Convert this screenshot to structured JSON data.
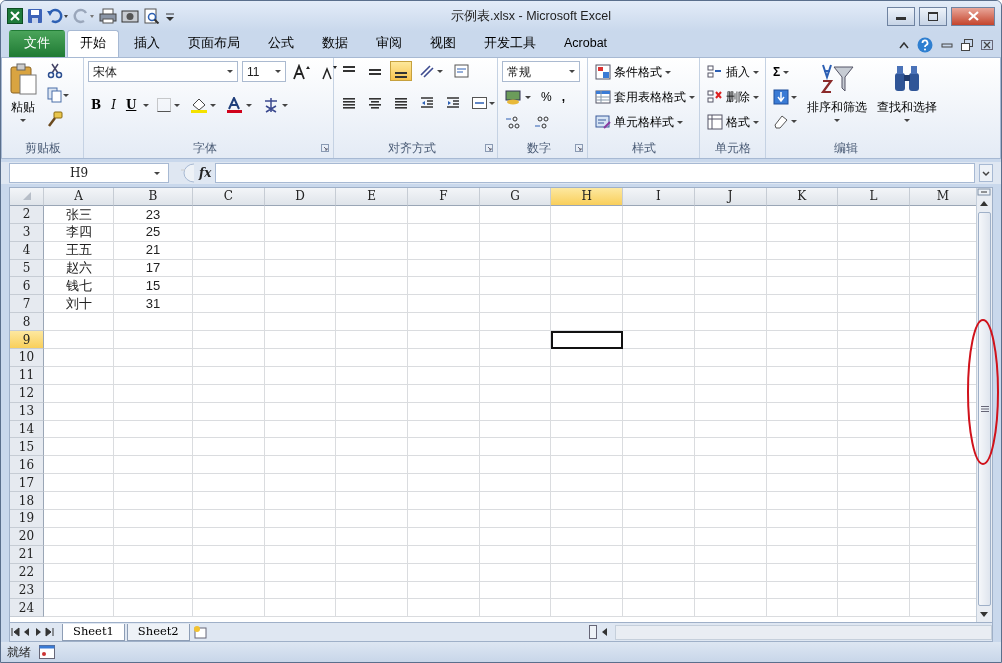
{
  "window": {
    "title": "示例表.xlsx - Microsoft Excel"
  },
  "tabs": [
    {
      "label": "文件",
      "kind": "file",
      "selected": false
    },
    {
      "label": "开始",
      "kind": "tab",
      "selected": true
    },
    {
      "label": "插入",
      "kind": "tab",
      "selected": false
    },
    {
      "label": "页面布局",
      "kind": "tab",
      "selected": false
    },
    {
      "label": "公式",
      "kind": "tab",
      "selected": false
    },
    {
      "label": "数据",
      "kind": "tab",
      "selected": false
    },
    {
      "label": "审阅",
      "kind": "tab",
      "selected": false
    },
    {
      "label": "视图",
      "kind": "tab",
      "selected": false
    },
    {
      "label": "开发工具",
      "kind": "tab",
      "selected": false
    },
    {
      "label": "Acrobat",
      "kind": "tab",
      "selected": false
    }
  ],
  "ribbon": {
    "groups": [
      {
        "kind": "clipboard",
        "label": "剪贴板",
        "paste": "粘贴"
      },
      {
        "kind": "font",
        "label": "字体",
        "font_name": "宋体",
        "font_size": "11",
        "bold": "B",
        "italic": "I",
        "underline": "U"
      },
      {
        "kind": "alignment",
        "label": "对齐方式"
      },
      {
        "kind": "number",
        "label": "数字",
        "format": "常规",
        "percent": "%",
        "comma": ","
      },
      {
        "kind": "styles",
        "label": "样式",
        "items": [
          "条件格式",
          "套用表格格式",
          "单元格样式"
        ]
      },
      {
        "kind": "cells",
        "label": "单元格",
        "items": [
          "插入",
          "删除",
          "格式"
        ]
      },
      {
        "kind": "editing",
        "label": "编辑",
        "sum": "Σ",
        "sort": "排序和筛选",
        "find": "查找和选择"
      }
    ]
  },
  "formula_bar": {
    "name_box": "H9",
    "fx": "fx"
  },
  "sheet": {
    "columns": [
      {
        "label": "A",
        "selected": false
      },
      {
        "label": "B",
        "selected": false
      },
      {
        "label": "C",
        "selected": false
      },
      {
        "label": "D",
        "selected": false
      },
      {
        "label": "E",
        "selected": false
      },
      {
        "label": "F",
        "selected": false
      },
      {
        "label": "G",
        "selected": false
      },
      {
        "label": "H",
        "selected": true
      },
      {
        "label": "I",
        "selected": false
      },
      {
        "label": "J",
        "selected": false
      },
      {
        "label": "K",
        "selected": false
      },
      {
        "label": "L",
        "selected": false
      },
      {
        "label": "M",
        "selected": false
      }
    ],
    "rows": [
      {
        "number": "2",
        "selected": false,
        "cells": [
          "张三",
          "23"
        ]
      },
      {
        "number": "3",
        "selected": false,
        "cells": [
          "李四",
          "25"
        ]
      },
      {
        "number": "4",
        "selected": false,
        "cells": [
          "王五",
          "21"
        ]
      },
      {
        "number": "5",
        "selected": false,
        "cells": [
          "赵六",
          "17"
        ]
      },
      {
        "number": "6",
        "selected": false,
        "cells": [
          "钱七",
          "15"
        ]
      },
      {
        "number": "7",
        "selected": false,
        "cells": [
          "刘十",
          "31"
        ]
      },
      {
        "number": "8",
        "selected": false,
        "cells": []
      },
      {
        "number": "9",
        "selected": true,
        "cells": []
      },
      {
        "number": "10",
        "selected": false,
        "cells": []
      },
      {
        "number": "11",
        "selected": false,
        "cells": []
      },
      {
        "number": "12",
        "selected": false,
        "cells": []
      },
      {
        "number": "13",
        "selected": false,
        "cells": []
      },
      {
        "number": "14",
        "selected": false,
        "cells": []
      },
      {
        "number": "15",
        "selected": false,
        "cells": []
      },
      {
        "number": "16",
        "selected": false,
        "cells": []
      },
      {
        "number": "17",
        "selected": false,
        "cells": []
      },
      {
        "number": "18",
        "selected": false,
        "cells": []
      },
      {
        "number": "19",
        "selected": false,
        "cells": []
      },
      {
        "number": "20",
        "selected": false,
        "cells": []
      },
      {
        "number": "21",
        "selected": false,
        "cells": []
      },
      {
        "number": "22",
        "selected": false,
        "cells": []
      },
      {
        "number": "23",
        "selected": false,
        "cells": []
      },
      {
        "number": "24",
        "selected": false,
        "cells": []
      }
    ]
  },
  "sheet_tabs": [
    {
      "label": "Sheet1",
      "selected": true
    },
    {
      "label": "Sheet2",
      "selected": false
    }
  ],
  "status_bar": {
    "text": "就绪"
  }
}
